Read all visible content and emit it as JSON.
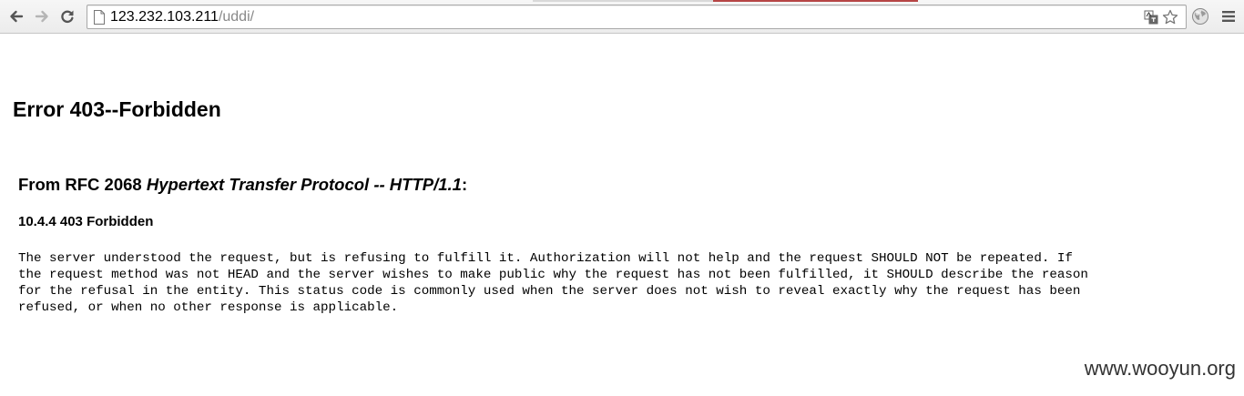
{
  "browser": {
    "url_host": "123.232.103.211",
    "url_path": "/uddi/",
    "icons": {
      "back": "back-arrow-icon",
      "forward": "forward-arrow-icon",
      "reload": "reload-icon",
      "page": "page-icon",
      "translate": "translate-icon",
      "bookmark": "star-icon",
      "extension": "globe-icon",
      "menu": "hamburger-menu-icon"
    }
  },
  "page": {
    "heading": "Error 403--Forbidden",
    "rfc_prefix": "From RFC 2068 ",
    "rfc_title": "Hypertext Transfer Protocol -- HTTP/1.1",
    "rfc_suffix": ":",
    "section_title": "10.4.4 403 Forbidden",
    "body_lines": [
      "The server understood the request, but is refusing to fulfill it. Authorization will not help and the request SHOULD NOT be repeated. If",
      "the request method was not HEAD and the server wishes to make public why the request has not been fulfilled, it SHOULD describe the reason",
      "for the refusal in the entity. This status code is commonly used when the server does not wish to reveal exactly why the request has been",
      "refused, or when no other response is applicable."
    ]
  },
  "watermark": "www.wooyun.org",
  "colors": {
    "url_path": "#888888",
    "tab_accent": "#b64545"
  }
}
